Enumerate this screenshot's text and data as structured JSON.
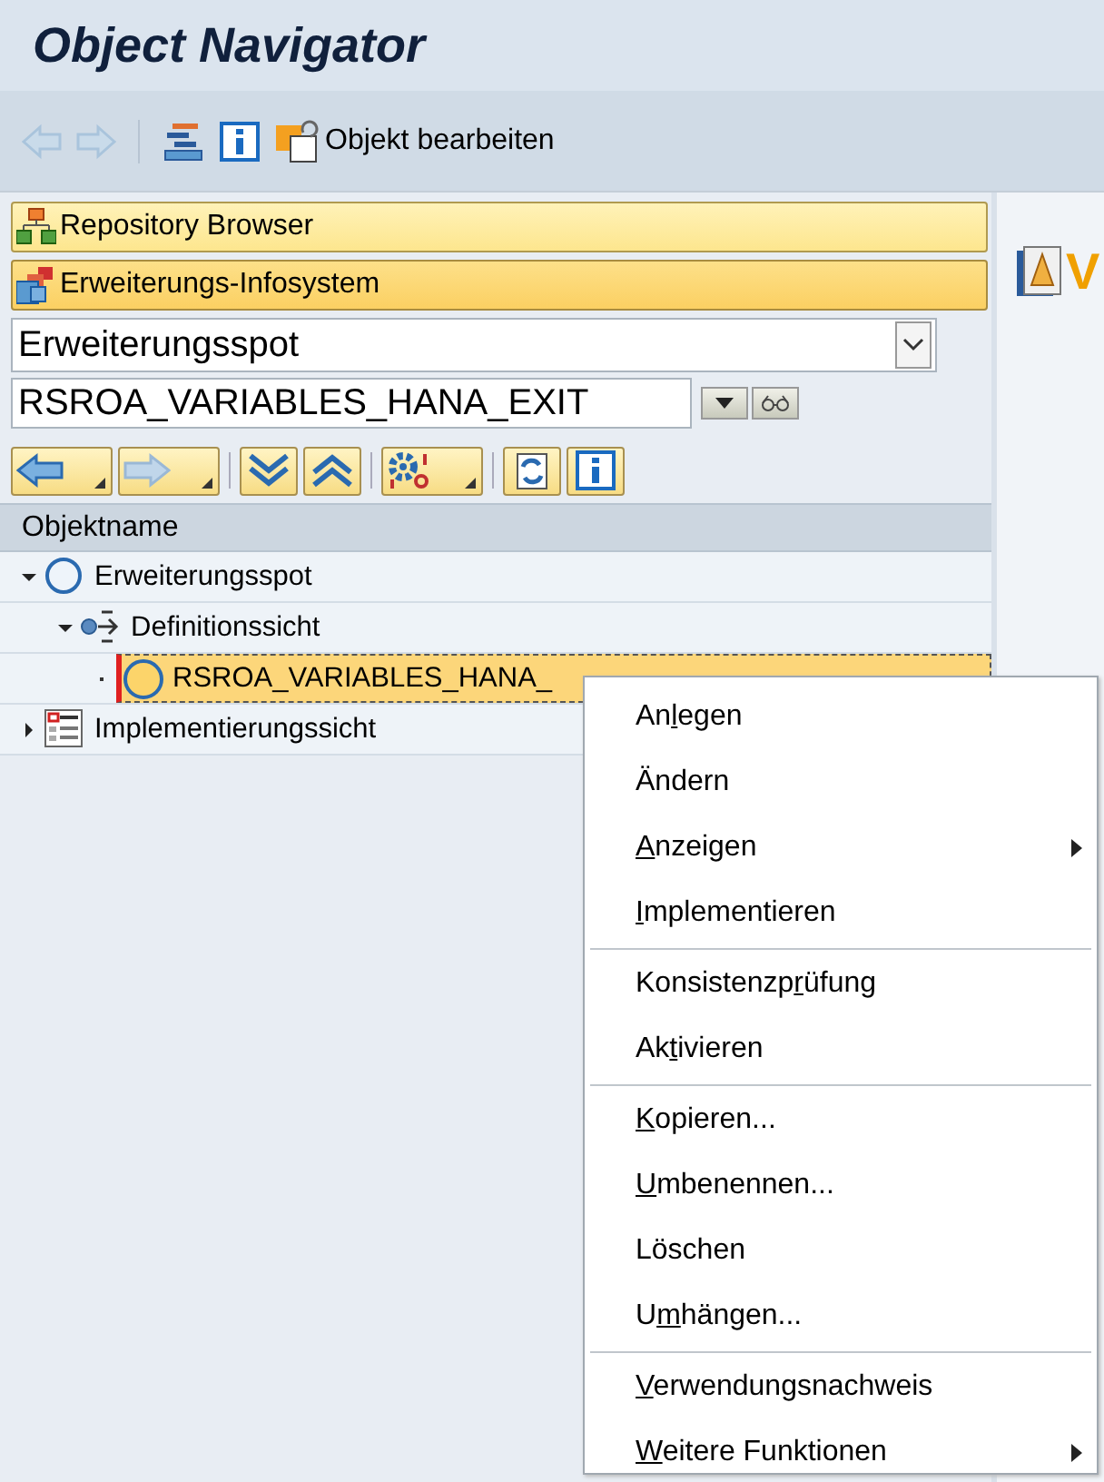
{
  "window": {
    "title": "Object Navigator"
  },
  "toolbar": {
    "back_disabled": true,
    "forward_disabled": true,
    "edit_label": "Objekt bearbeiten"
  },
  "browsers": [
    {
      "label": "Repository Browser",
      "kind": "repository",
      "selected": false
    },
    {
      "label": "Erweiterungs-Infosystem",
      "kind": "enhancement",
      "selected": true
    }
  ],
  "object_type": {
    "value": "Erweiterungsspot"
  },
  "object_name": {
    "value": "RSROA_VARIABLES_HANA_EXIT"
  },
  "tree": {
    "column": "Objektname",
    "items": [
      {
        "label": "Erweiterungsspot",
        "kind": "spot",
        "expanded": true,
        "selected": false,
        "children": [
          {
            "label": "Definitionssicht",
            "kind": "definition",
            "expanded": true,
            "selected": false,
            "children": [
              {
                "label": "RSROA_VARIABLES_HANA_",
                "kind": "badi",
                "selected": true
              }
            ]
          }
        ]
      },
      {
        "label": "Implementierungssicht",
        "kind": "implementation",
        "expanded": false,
        "selected": false
      }
    ]
  },
  "right_pane": {
    "heading": "V"
  },
  "context_menu": {
    "groups": [
      [
        {
          "lead": "An",
          "key": "l",
          "rest": "egen",
          "submenu": false
        },
        {
          "lead": "Ändern",
          "submenu": false
        },
        {
          "key": "A",
          "rest": "nzeigen",
          "submenu": true
        },
        {
          "key": "I",
          "rest": "mplementieren",
          "submenu": false
        }
      ],
      [
        {
          "lead": "Konsistenzp",
          "key": "r",
          "rest": "üfung",
          "submenu": false
        },
        {
          "lead": "Ak",
          "key": "t",
          "rest": "ivieren",
          "submenu": false
        }
      ],
      [
        {
          "key": "K",
          "rest": "opieren...",
          "submenu": false
        },
        {
          "key": "U",
          "rest": "mbenennen...",
          "submenu": false
        },
        {
          "lead": "Löschen",
          "submenu": false
        },
        {
          "lead": "U",
          "key": "m",
          "rest": "hängen...",
          "submenu": false
        }
      ],
      [
        {
          "key": "V",
          "rest": "erwendungsnachweis",
          "submenu": false
        },
        {
          "key": "W",
          "rest": "eitere Funktionen",
          "submenu": true
        }
      ]
    ]
  }
}
